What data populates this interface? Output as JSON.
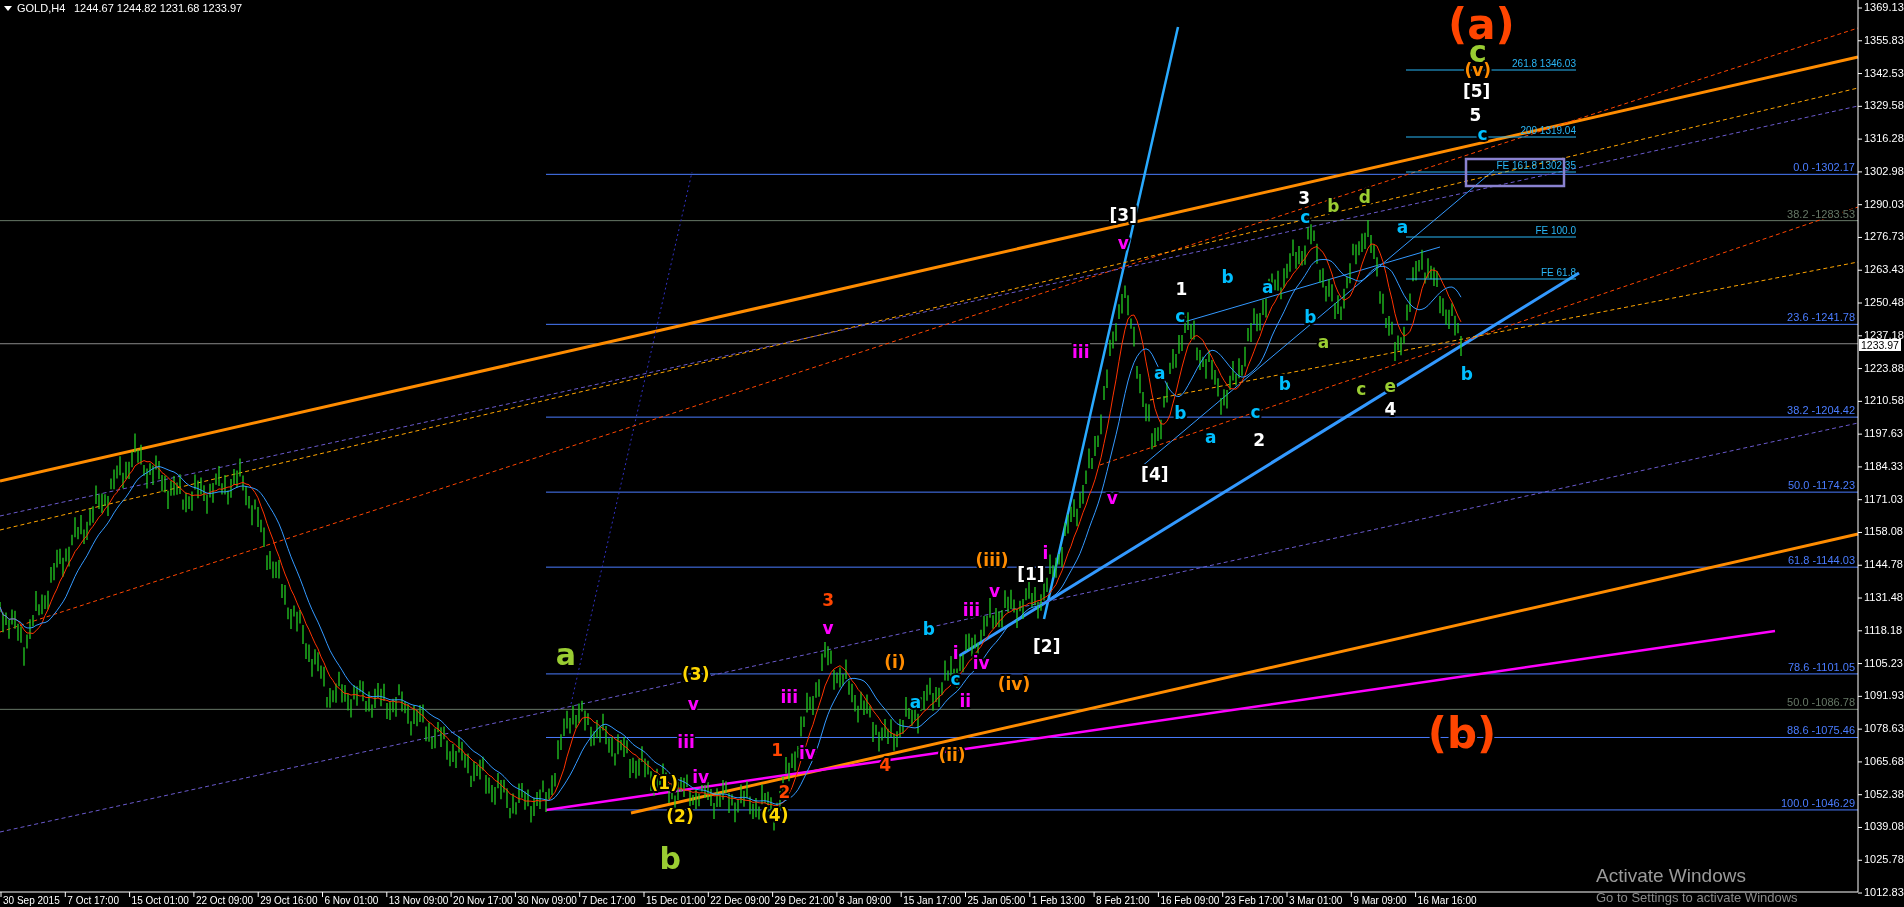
{
  "header": {
    "symbol": "GOLD,H4",
    "ohlc": "1244.67 1244.82 1231.68 1233.97"
  },
  "price_axis": {
    "ticks": [
      "1369.13",
      "1355.83",
      "1342.53",
      "1329.58",
      "1316.28",
      "1302.98",
      "1290.03",
      "1276.73",
      "1263.43",
      "1250.48",
      "1237.18",
      "1223.88",
      "1210.58",
      "1197.63",
      "1184.33",
      "1171.03",
      "1158.08",
      "1144.78",
      "1131.48",
      "1118.18",
      "1105.23",
      "1091.93",
      "1078.63",
      "1065.68",
      "1052.38",
      "1039.08",
      "1025.78",
      "1012.83"
    ],
    "current_price": "1233.97"
  },
  "time_axis": {
    "ticks": [
      "30 Sep 2015",
      "7 Oct 17:00",
      "15 Oct 01:00",
      "22 Oct 09:00",
      "29 Oct 16:00",
      "6 Nov 01:00",
      "13 Nov 09:00",
      "20 Nov 17:00",
      "30 Nov 09:00",
      "7 Dec 17:00",
      "15 Dec 01:00",
      "22 Dec 09:00",
      "29 Dec 21:00",
      "8 Jan 09:00",
      "15 Jan 17:00",
      "25 Jan 05:00",
      "1 Feb 13:00",
      "8 Feb 21:00",
      "16 Feb 09:00",
      "23 Feb 17:00",
      "3 Mar 01:00",
      "9 Mar 09:00",
      "16 Mar 16:00"
    ]
  },
  "fib_levels": [
    {
      "label": "0.0 -1302.17",
      "color": "#4a7cff"
    },
    {
      "label": "38.2 -1283.53",
      "color": "#667766"
    },
    {
      "label": "23.6 -1241.78",
      "color": "#4a7cff"
    },
    {
      "label": "38.2 -1204.42",
      "color": "#4a7cff"
    },
    {
      "label": "50.0 -1174.23",
      "color": "#4a7cff"
    },
    {
      "label": "61.8 -1144.03",
      "color": "#4a7cff"
    },
    {
      "label": "78.6 -1101.05",
      "color": "#4a7cff"
    },
    {
      "label": "50.0 -1086.78",
      "color": "#667766"
    },
    {
      "label": "88.6 -1075.46",
      "color": "#4a7cff"
    },
    {
      "label": "100.0 -1046.29",
      "color": "#4a7cff"
    }
  ],
  "fib_extensions": [
    {
      "label": "261.8 1346.03",
      "highlighted": false
    },
    {
      "label": "200 1319.04",
      "highlighted": false
    },
    {
      "label": "FE 161.8 1302.35",
      "highlighted": true
    },
    {
      "label": "FE 100.0",
      "highlighted": false
    },
    {
      "label": "FE 61.8",
      "highlighted": false
    }
  ],
  "wave_labels": [
    {
      "text": "(a)",
      "color": "#ff4500",
      "kind": "degree"
    },
    {
      "text": "c",
      "color": "#9acd32",
      "kind": "major"
    },
    {
      "text": "(v)",
      "color": "#ff8c00",
      "kind": "minor"
    },
    {
      "text": "[5]",
      "color": "#ffffff",
      "kind": "minor"
    },
    {
      "text": "5",
      "color": "#ffffff",
      "kind": "minor"
    },
    {
      "text": "c",
      "color": "#00bfff",
      "kind": "minor"
    },
    {
      "text": "[3]",
      "color": "#ffffff",
      "kind": "minor"
    },
    {
      "text": "v",
      "color": "#ff00ff",
      "kind": "minor"
    },
    {
      "text": "3",
      "color": "#ffffff",
      "kind": "minor"
    },
    {
      "text": "c",
      "color": "#00bfff",
      "kind": "minor"
    },
    {
      "text": "b",
      "color": "#9acd32",
      "kind": "minor"
    },
    {
      "text": "d",
      "color": "#9acd32",
      "kind": "minor"
    },
    {
      "text": "a",
      "color": "#00bfff",
      "kind": "minor"
    },
    {
      "text": "1",
      "color": "#ffffff",
      "kind": "minor"
    },
    {
      "text": "c",
      "color": "#00bfff",
      "kind": "minor"
    },
    {
      "text": "b",
      "color": "#00bfff",
      "kind": "minor"
    },
    {
      "text": "a",
      "color": "#00bfff",
      "kind": "minor"
    },
    {
      "text": "b",
      "color": "#00bfff",
      "kind": "minor"
    },
    {
      "text": "a",
      "color": "#9acd32",
      "kind": "minor"
    },
    {
      "text": "iii",
      "color": "#ff00ff",
      "kind": "minor"
    },
    {
      "text": "a",
      "color": "#00bfff",
      "kind": "minor"
    },
    {
      "text": "c",
      "color": "#9acd32",
      "kind": "minor"
    },
    {
      "text": "e",
      "color": "#9acd32",
      "kind": "minor"
    },
    {
      "text": "b",
      "color": "#00bfff",
      "kind": "minor"
    },
    {
      "text": "c",
      "color": "#00bfff",
      "kind": "minor"
    },
    {
      "text": "b",
      "color": "#00bfff",
      "kind": "minor"
    },
    {
      "text": "4",
      "color": "#ffffff",
      "kind": "minor"
    },
    {
      "text": "2",
      "color": "#ffffff",
      "kind": "minor"
    },
    {
      "text": "b",
      "color": "#00bfff",
      "kind": "minor"
    },
    {
      "text": "a",
      "color": "#00bfff",
      "kind": "minor"
    },
    {
      "text": "[4]",
      "color": "#ffffff",
      "kind": "minor"
    },
    {
      "text": "v",
      "color": "#ff00ff",
      "kind": "minor"
    },
    {
      "text": "(iii)",
      "color": "#ff8c00",
      "kind": "minor"
    },
    {
      "text": "[1]",
      "color": "#ffffff",
      "kind": "minor"
    },
    {
      "text": "i",
      "color": "#ff00ff",
      "kind": "minor"
    },
    {
      "text": "v",
      "color": "#ff00ff",
      "kind": "minor"
    },
    {
      "text": "iii",
      "color": "#ff00ff",
      "kind": "minor"
    },
    {
      "text": "b",
      "color": "#00bfff",
      "kind": "minor"
    },
    {
      "text": "3",
      "color": "#ff4500",
      "kind": "minor"
    },
    {
      "text": "v",
      "color": "#ff00ff",
      "kind": "minor"
    },
    {
      "text": "[2]",
      "color": "#ffffff",
      "kind": "minor"
    },
    {
      "text": "(i)",
      "color": "#ff8c00",
      "kind": "minor"
    },
    {
      "text": "i",
      "color": "#ff00ff",
      "kind": "minor"
    },
    {
      "text": "(iv)",
      "color": "#ff8c00",
      "kind": "minor"
    },
    {
      "text": "iv",
      "color": "#ff00ff",
      "kind": "minor"
    },
    {
      "text": "c",
      "color": "#00bfff",
      "kind": "minor"
    },
    {
      "text": "iii",
      "color": "#ff00ff",
      "kind": "minor"
    },
    {
      "text": "a",
      "color": "#00bfff",
      "kind": "minor"
    },
    {
      "text": "ii",
      "color": "#ff00ff",
      "kind": "minor"
    },
    {
      "text": "(ii)",
      "color": "#ff8c00",
      "kind": "minor"
    },
    {
      "text": "4",
      "color": "#ff4500",
      "kind": "minor"
    },
    {
      "text": "a",
      "color": "#9acd32",
      "kind": "major"
    },
    {
      "text": "(3)",
      "color": "#ffd700",
      "kind": "minor"
    },
    {
      "text": "v",
      "color": "#ff00ff",
      "kind": "minor"
    },
    {
      "text": "iii",
      "color": "#ff00ff",
      "kind": "minor"
    },
    {
      "text": "iv",
      "color": "#ff00ff",
      "kind": "minor"
    },
    {
      "text": "1",
      "color": "#ff4500",
      "kind": "minor"
    },
    {
      "text": "iv",
      "color": "#ff00ff",
      "kind": "minor"
    },
    {
      "text": "2",
      "color": "#ff4500",
      "kind": "minor"
    },
    {
      "text": "(1)",
      "color": "#ffd700",
      "kind": "minor"
    },
    {
      "text": "(2)",
      "color": "#ffd700",
      "kind": "minor"
    },
    {
      "text": "(4)",
      "color": "#ffd700",
      "kind": "minor"
    },
    {
      "text": "b",
      "color": "#9acd32",
      "kind": "major"
    },
    {
      "text": "(b)",
      "color": "#ff4500",
      "kind": "degree"
    }
  ],
  "os_notice": {
    "title": "Activate Windows",
    "message": "Go to Settings to activate Windows"
  }
}
